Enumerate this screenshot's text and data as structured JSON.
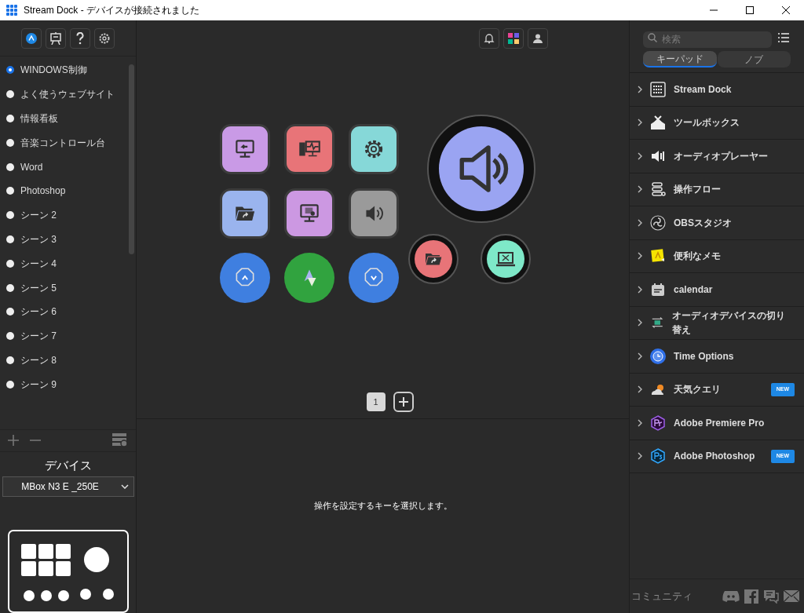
{
  "window": {
    "title": "Stream Dock - デバイスが接続されました"
  },
  "scenes": [
    {
      "label": "WINDOWS制御",
      "selected": true
    },
    {
      "label": "よく使うウェブサイト",
      "selected": false
    },
    {
      "label": "情報看板",
      "selected": false
    },
    {
      "label": "音楽コントロール台",
      "selected": false
    },
    {
      "label": "Word",
      "selected": false
    },
    {
      "label": "Photoshop",
      "selected": false
    },
    {
      "label": "シーン 2",
      "selected": false
    },
    {
      "label": "シーン 3",
      "selected": false
    },
    {
      "label": "シーン 4",
      "selected": false
    },
    {
      "label": "シーン 5",
      "selected": false
    },
    {
      "label": "シーン 6",
      "selected": false
    },
    {
      "label": "シーン 7",
      "selected": false
    },
    {
      "label": "シーン 8",
      "selected": false
    },
    {
      "label": "シーン 9",
      "selected": false
    }
  ],
  "device": {
    "heading": "デバイス",
    "value": "MBox N3 E _250E"
  },
  "keys": [
    {
      "kind": "square",
      "color": "#c99ae6"
    },
    {
      "kind": "square",
      "color": "#e87478"
    },
    {
      "kind": "square",
      "color": "#86d8d8"
    },
    {
      "kind": "square",
      "color": "#9ab4ee"
    },
    {
      "kind": "square",
      "color": "#cc98e2"
    },
    {
      "kind": "square",
      "color": "#9a9a9a"
    },
    {
      "kind": "round",
      "color": "#3f7fe0"
    },
    {
      "kind": "round",
      "color": "#31a33f"
    },
    {
      "kind": "round",
      "color": "#3f7fe0"
    }
  ],
  "knobs": [
    {
      "kind": "large",
      "color": "#9aa4f2"
    },
    {
      "kind": "small",
      "color": "#e87478"
    },
    {
      "kind": "small",
      "color": "#7ee8c8"
    }
  ],
  "pages": [
    {
      "label": "1",
      "selected": true
    }
  ],
  "hint": "操作を設定するキーを選択します。",
  "search": {
    "placeholder": "検索"
  },
  "tabs": [
    {
      "label": "キーパッド",
      "selected": true
    },
    {
      "label": "ノブ",
      "selected": false
    }
  ],
  "plugins": [
    {
      "label": "Stream Dock"
    },
    {
      "label": "ツールボックス"
    },
    {
      "label": "オーディオプレーヤー"
    },
    {
      "label": "操作フロー"
    },
    {
      "label": "OBSスタジオ"
    },
    {
      "label": "便利なメモ"
    },
    {
      "label": "calendar"
    },
    {
      "label": "オーディオデバイスの切り替え"
    },
    {
      "label": "Time Options"
    },
    {
      "label": "天気クエリ",
      "badge": "NEW"
    },
    {
      "label": "Adobe Premiere Pro"
    },
    {
      "label": "Adobe Photoshop",
      "badge": "NEW"
    }
  ],
  "footer": {
    "label": "コミュニティ"
  }
}
